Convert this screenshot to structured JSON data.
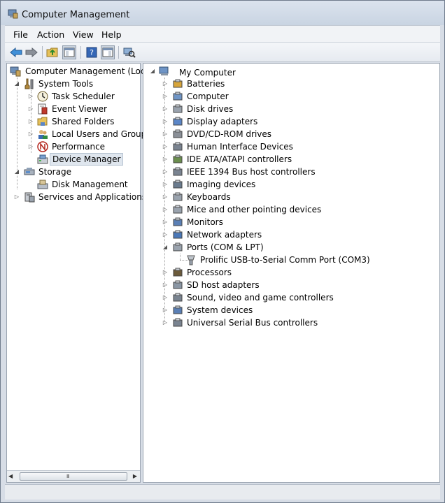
{
  "window": {
    "title": "Computer Management"
  },
  "menu": [
    "File",
    "Action",
    "View",
    "Help"
  ],
  "toolbar": {
    "buttons": [
      "back-arrow-icon",
      "forward-arrow-icon",
      "up-folder-icon",
      "show-hide-tree-icon",
      "help-icon",
      "action-pane-icon",
      "scan-hardware-icon"
    ]
  },
  "tree": {
    "root": "Computer Management (Local",
    "system_tools": "System Tools",
    "system_tools_items": [
      "Task Scheduler",
      "Event Viewer",
      "Shared Folders",
      "Local Users and Groups",
      "Performance",
      "Device Manager"
    ],
    "storage": "Storage",
    "storage_items": [
      "Disk Management"
    ],
    "services": "Services and Applications"
  },
  "devices": {
    "root": "My Computer",
    "categories": [
      "Batteries",
      "Computer",
      "Disk drives",
      "Display adapters",
      "DVD/CD-ROM drives",
      "Human Interface Devices",
      "IDE ATA/ATAPI controllers",
      "IEEE 1394 Bus host controllers",
      "Imaging devices",
      "Keyboards",
      "Mice and other pointing devices",
      "Monitors",
      "Network adapters",
      "Ports (COM & LPT)"
    ],
    "ports_child": "Prolific USB-to-Serial Comm Port (COM3)",
    "categories_after": [
      "Processors",
      "SD host adapters",
      "Sound, video and game controllers",
      "System devices",
      "Universal Serial Bus controllers"
    ]
  },
  "scrollbar": {
    "grip": "III"
  }
}
